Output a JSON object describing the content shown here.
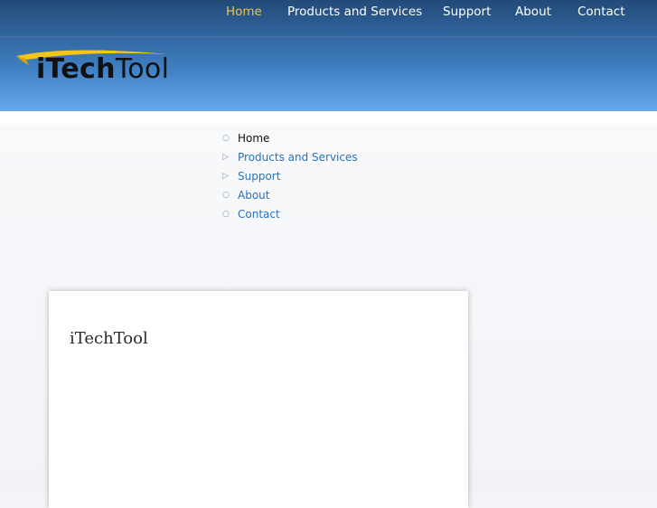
{
  "top_nav": {
    "items": [
      {
        "label": "Home",
        "active": true
      },
      {
        "label": "Products and Services",
        "active": false
      },
      {
        "label": "Support",
        "active": false
      },
      {
        "label": "About",
        "active": false
      },
      {
        "label": "Contact",
        "active": false
      }
    ]
  },
  "logo": {
    "text_bold": "iTech",
    "text_light": "Tool"
  },
  "sub_menu": {
    "items": [
      {
        "label": "Home",
        "bullet": "○",
        "current": true
      },
      {
        "label": "Products and Services",
        "bullet": "▷",
        "current": false
      },
      {
        "label": "Support",
        "bullet": "▷",
        "current": false
      },
      {
        "label": "About",
        "bullet": "○",
        "current": false
      },
      {
        "label": "Contact",
        "bullet": "○",
        "current": false
      }
    ]
  },
  "card": {
    "title": "iTechTool"
  },
  "colors": {
    "header_top": "#234a78",
    "header_bottom": "#6aa8ea",
    "active_nav": "#e8c458",
    "link": "#2a72b8",
    "logo_swoosh": "#f5c518"
  }
}
